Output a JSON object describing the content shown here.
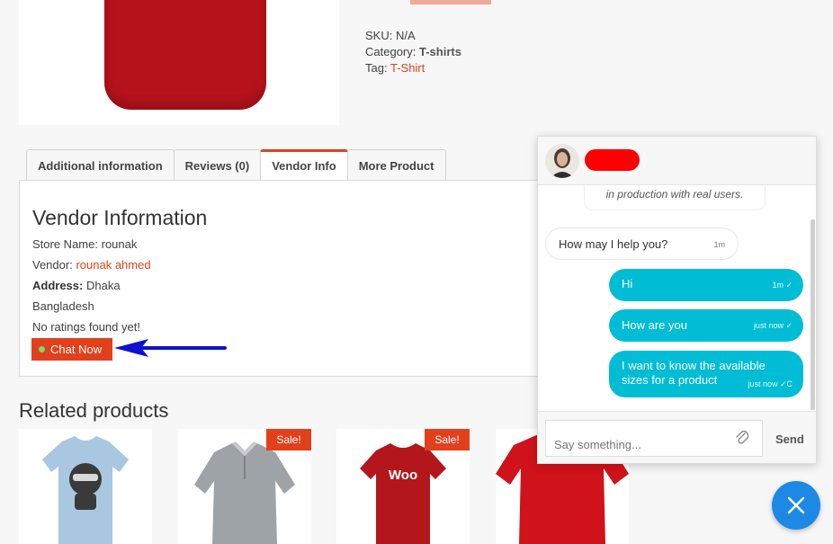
{
  "product": {
    "sku_label": "SKU:",
    "sku_value": "N/A",
    "category_label": "Category:",
    "category_value": "T-shirts",
    "tag_label": "Tag:",
    "tag_value": "T-Shirt"
  },
  "tabs": [
    {
      "label": "Additional information"
    },
    {
      "label": "Reviews (0)"
    },
    {
      "label": "Vendor Info",
      "active": true
    },
    {
      "label": "More Product"
    }
  ],
  "vendor": {
    "title": "Vendor Information",
    "store_label": "Store Name:",
    "store_value": "rounak",
    "vendor_label": "Vendor:",
    "vendor_value": "rounak ahmed",
    "address_label": "Address:",
    "address_value": "Dhaka",
    "country": "Bangladesh",
    "ratings": "No ratings found yet!",
    "chat_button": "Chat Now"
  },
  "related": {
    "title": "Related products",
    "sale_badge": "Sale!",
    "items": [
      {
        "icon": "ninja-tshirt",
        "sale": false
      },
      {
        "icon": "gray-polo",
        "sale": true
      },
      {
        "icon": "woo-tshirt",
        "sale": true,
        "print": "Woo"
      },
      {
        "icon": "red-polo",
        "sale": false
      }
    ]
  },
  "chat": {
    "system_message": "in production with real users.",
    "messages": [
      {
        "direction": "in",
        "text": "How may I help you?",
        "time": "1m"
      },
      {
        "direction": "out",
        "text": "Hi",
        "time": "1m ✓"
      },
      {
        "direction": "out",
        "text": "How are you",
        "time": "just now ✓"
      },
      {
        "direction": "out",
        "text": "I want to know the available sizes for a product",
        "time": "just now ✓C"
      }
    ],
    "input_placeholder": "Say something...",
    "send_label": "Send"
  },
  "colors": {
    "accent": "#e2401c",
    "chat_bubble": "#00bcd4",
    "fab": "#1e88e5",
    "redaction": "#ff0000",
    "arrow": "#1010d0"
  }
}
